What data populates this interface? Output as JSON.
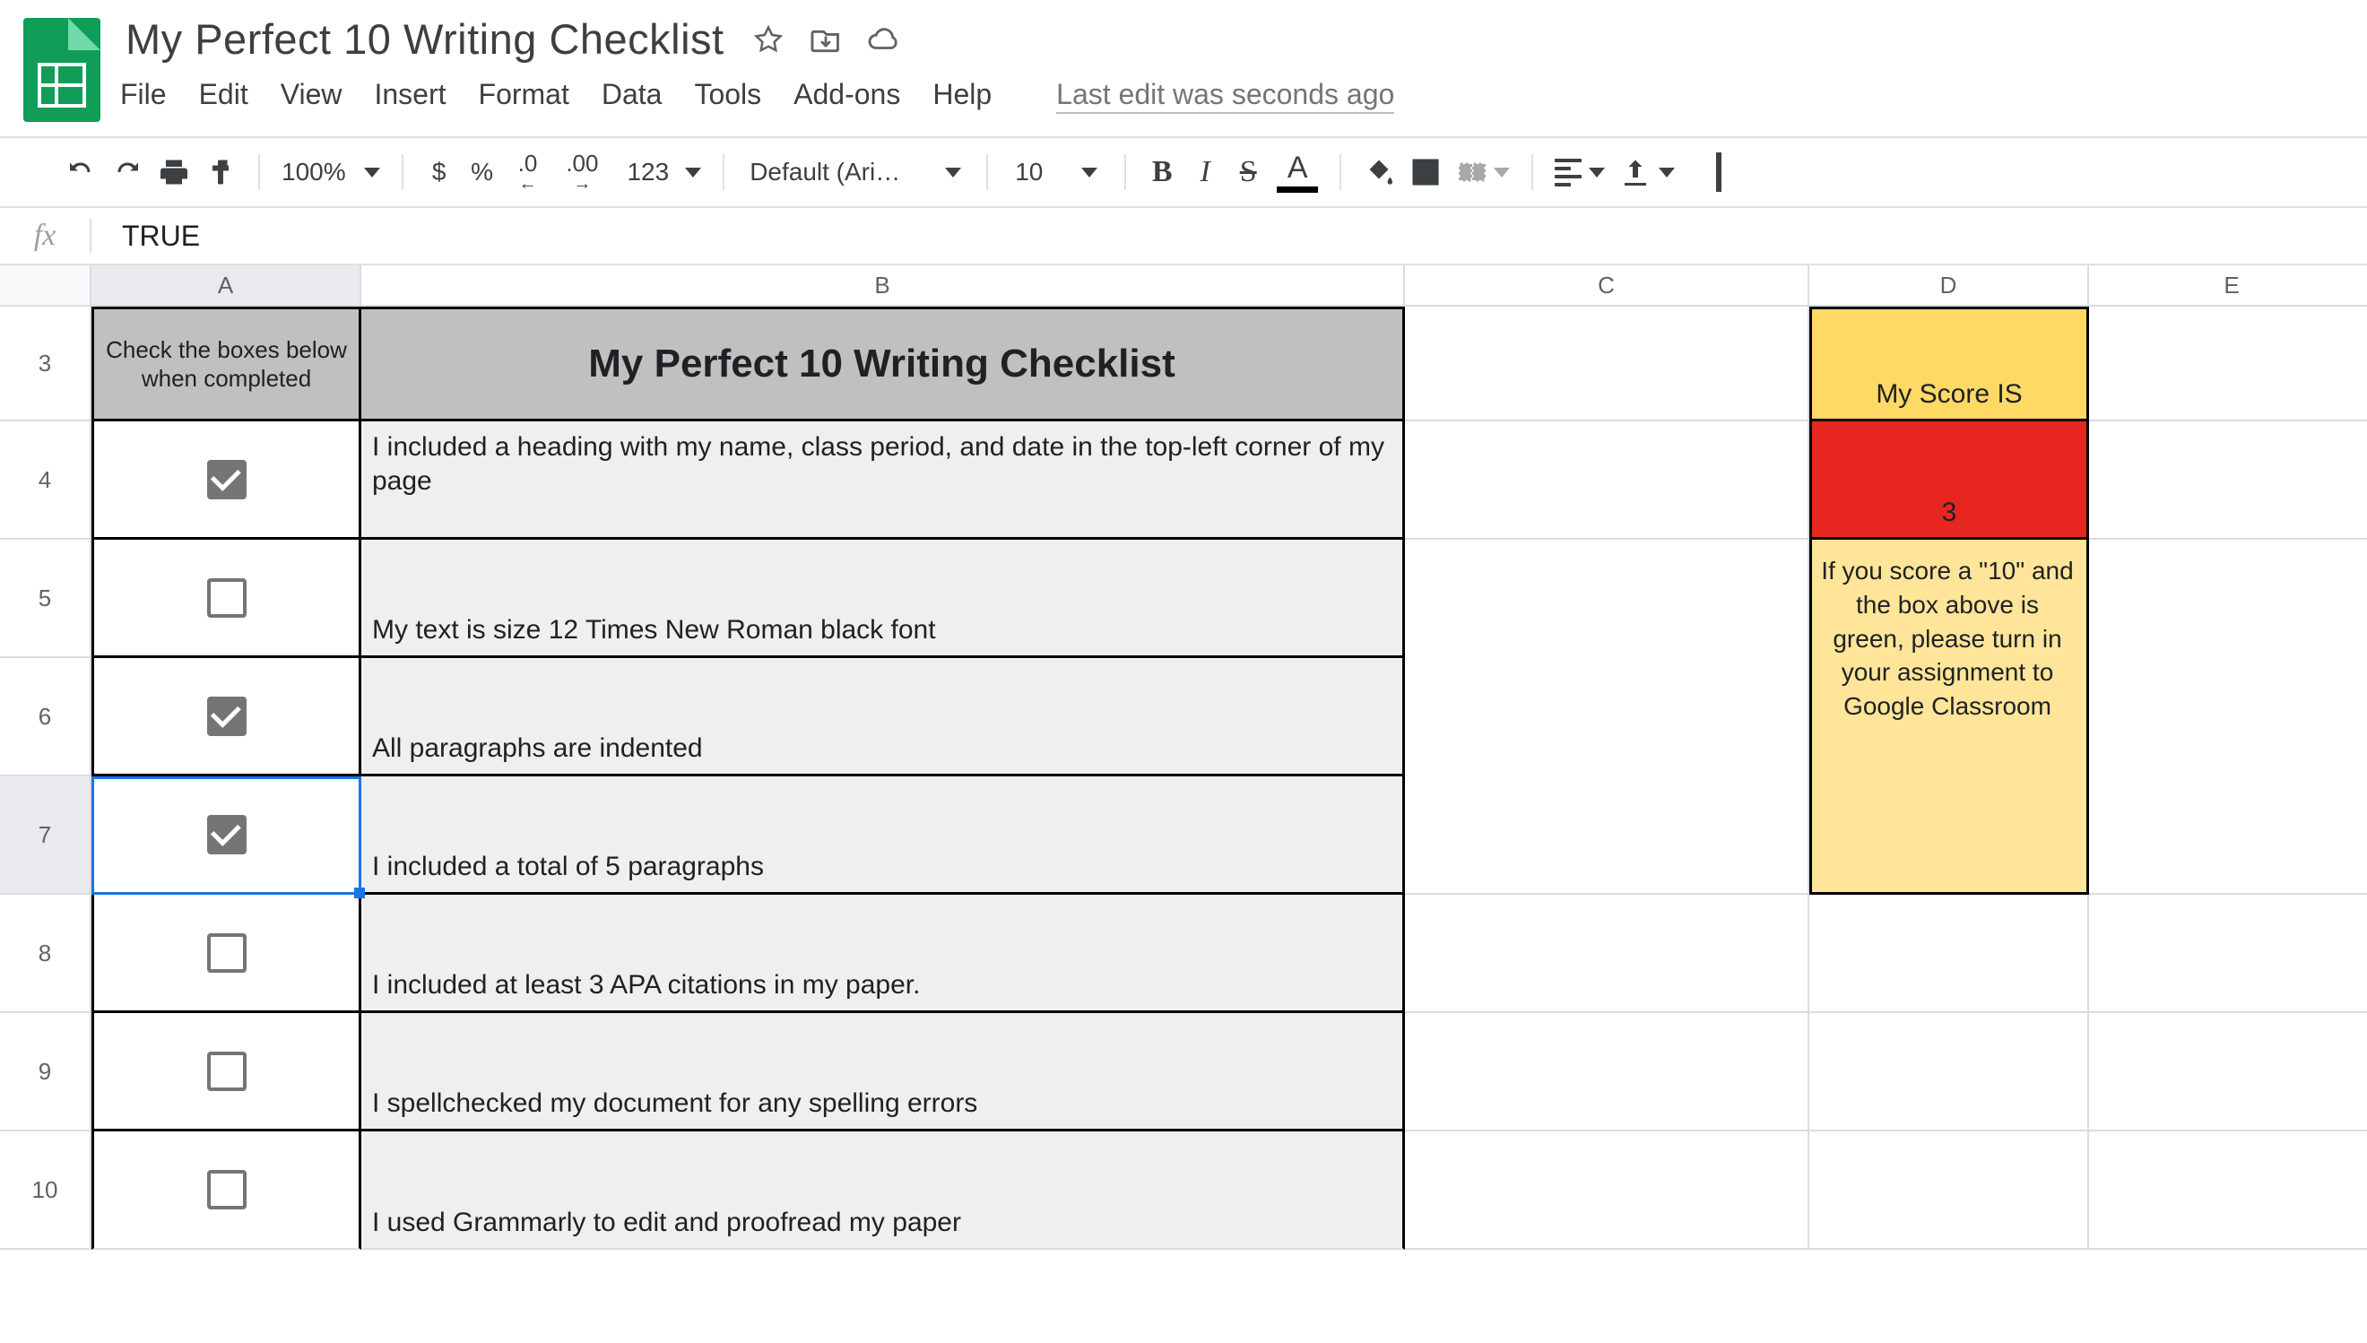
{
  "doc": {
    "title": "My Perfect 10 Writing Checklist",
    "last_edit": "Last edit was seconds ago"
  },
  "menus": [
    "File",
    "Edit",
    "View",
    "Insert",
    "Format",
    "Data",
    "Tools",
    "Add-ons",
    "Help"
  ],
  "toolbar": {
    "zoom": "100%",
    "currency": "$",
    "percent": "%",
    "dec_dec": ".0",
    "dec_inc": ".00",
    "num_fmt": "123",
    "font": "Default (Ari…",
    "font_size": "10",
    "bold": "B",
    "italic": "I",
    "strike": "S",
    "text_color": "A"
  },
  "formula_bar": {
    "fx": "fx",
    "value": "TRUE"
  },
  "columns": [
    "A",
    "B",
    "C",
    "D",
    "E"
  ],
  "row_numbers": [
    "3",
    "4",
    "5",
    "6",
    "7",
    "8",
    "9",
    "10"
  ],
  "active_cell": "A7",
  "header_a": "Check the boxes below when completed",
  "header_b": "My Perfect 10 Writing Checklist",
  "items": [
    {
      "checked": true,
      "text": "I included a heading with my name, class period, and date in the top-left corner of my page"
    },
    {
      "checked": false,
      "text": "My text is size 12 Times New Roman black font"
    },
    {
      "checked": true,
      "text": "All paragraphs are indented"
    },
    {
      "checked": true,
      "text": "I included a total of 5 paragraphs"
    },
    {
      "checked": false,
      "text": "I included at least 3 APA citations in my paper."
    },
    {
      "checked": false,
      "text": "I spellchecked my document for any spelling errors"
    },
    {
      "checked": false,
      "text": "I used Grammarly to edit and proofread my paper"
    }
  ],
  "score": {
    "label": "My Score IS",
    "value": "3",
    "note": "If you score a \"10\" and the box above is green, please turn in your assignment to Google Classroom"
  },
  "colors": {
    "header_grey": "#c0c0c0",
    "row_grey": "#efefef",
    "score_label_bg": "#ffd966",
    "score_val_bg": "#e6261f",
    "score_note_bg": "#ffe599",
    "accent": "#1a73e8"
  }
}
